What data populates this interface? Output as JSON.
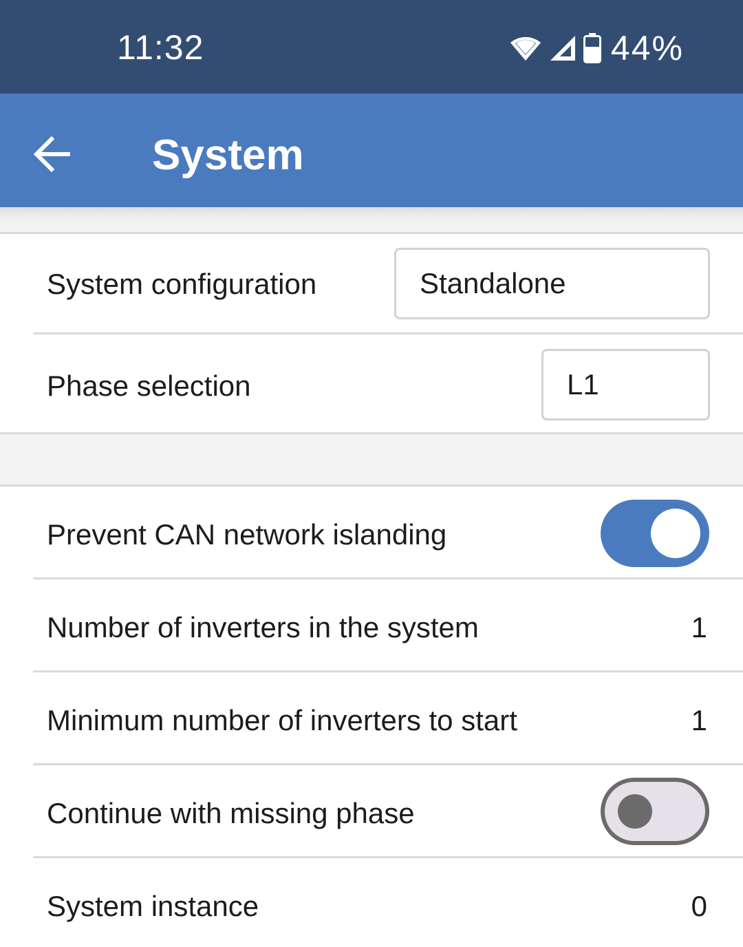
{
  "status_bar": {
    "time": "11:32",
    "battery_percent": "44%",
    "icons": [
      "wifi-icon",
      "cell-signal-icon",
      "battery-icon"
    ]
  },
  "app_bar": {
    "title": "System",
    "back_icon": "arrow-left-icon"
  },
  "colors": {
    "status_bar": "#334d72",
    "app_bar": "#4a7bbf",
    "toggle_on": "#4a7bbf",
    "toggle_off_track": "#e6e0e9",
    "toggle_off_border": "#6b6b6b"
  },
  "settings": {
    "system_configuration": {
      "label": "System configuration",
      "value": "Standalone"
    },
    "phase_selection": {
      "label": "Phase selection",
      "value": "L1"
    },
    "prevent_can_islanding": {
      "label": "Prevent CAN network islanding",
      "enabled": true
    },
    "number_of_inverters": {
      "label": "Number of inverters in the system",
      "value": "1"
    },
    "min_inverters_to_start": {
      "label": "Minimum number of inverters to start",
      "value": "1"
    },
    "continue_missing_phase": {
      "label": "Continue with missing phase",
      "enabled": false
    },
    "system_instance": {
      "label": "System instance",
      "value": "0"
    }
  }
}
